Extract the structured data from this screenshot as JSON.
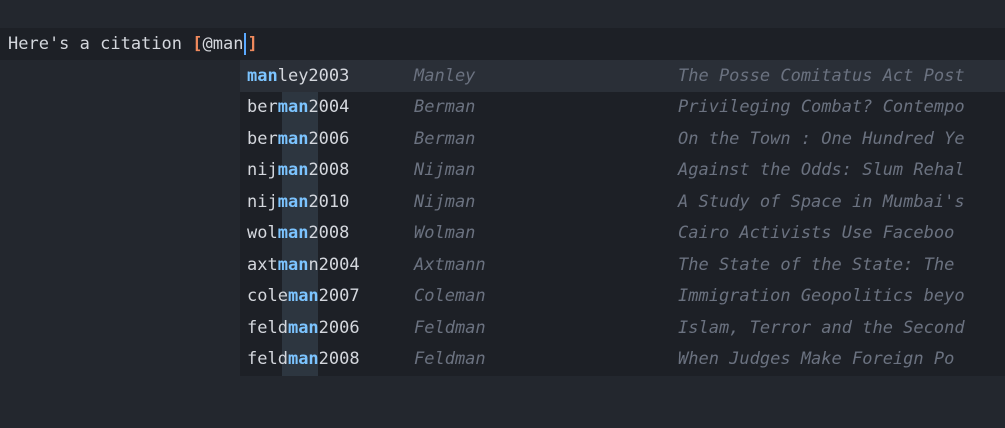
{
  "editor": {
    "prefix": "Here's a citation ",
    "open_bracket": "[",
    "typed": "@man",
    "close_bracket": "]"
  },
  "completion": {
    "query": "man",
    "items": [
      {
        "key_pre": "",
        "key_match": "man",
        "key_post": "ley2003",
        "author": "Manley",
        "title": "The Posse Comitatus Act Post"
      },
      {
        "key_pre": "ber",
        "key_match": "man",
        "key_post": "2004",
        "author": "Berman",
        "title": "Privileging Combat? Contempo"
      },
      {
        "key_pre": "ber",
        "key_match": "man",
        "key_post": "2006",
        "author": "Berman",
        "title": "On the Town : One Hundred Ye"
      },
      {
        "key_pre": "nij",
        "key_match": "man",
        "key_post": "2008",
        "author": "Nijman",
        "title": "Against the Odds: Slum Rehal"
      },
      {
        "key_pre": "nij",
        "key_match": "man",
        "key_post": "2010",
        "author": "Nijman",
        "title": "A Study of Space in Mumbai's"
      },
      {
        "key_pre": "wol",
        "key_match": "man",
        "key_post": "2008",
        "author": "Wolman",
        "title": "Cairo Activists Use Faceboo"
      },
      {
        "key_pre": "axt",
        "key_match": "man",
        "key_post": "n2004",
        "author": "Axtmann",
        "title": "The State of the State: The"
      },
      {
        "key_pre": "cole",
        "key_match": "man",
        "key_post": "2007",
        "author": "Coleman",
        "title": "Immigration Geopolitics beyo"
      },
      {
        "key_pre": "feld",
        "key_match": "man",
        "key_post": "2006",
        "author": "Feldman",
        "title": "Islam, Terror and the Second"
      },
      {
        "key_pre": "feld",
        "key_match": "man",
        "key_post": "2008",
        "author": "Feldman",
        "title": "When Judges Make Foreign Po"
      }
    ]
  }
}
